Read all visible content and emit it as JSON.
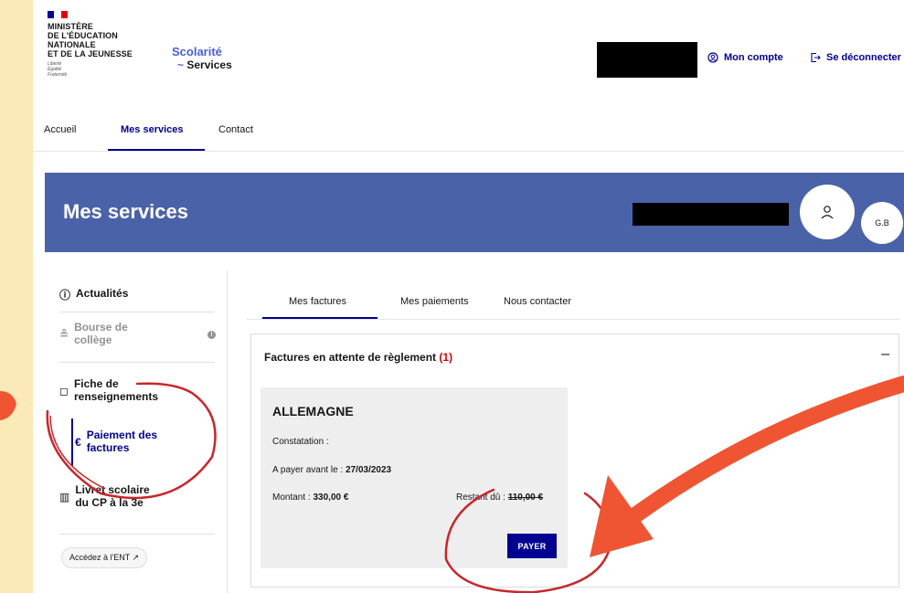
{
  "header": {
    "ministry_lines": [
      "MINISTÈRE",
      "DE L'ÉDUCATION",
      "NATIONALE",
      "ET DE LA JEUNESSE"
    ],
    "motto": [
      "Liberté",
      "Égalité",
      "Fraternité"
    ],
    "brand_top": "Scolarité",
    "brand_bottom": "Services",
    "account_label": "Mon compte",
    "logout_label": "Se déconnecter"
  },
  "nav": {
    "items": [
      "Accueil",
      "Mes services",
      "Contact"
    ],
    "active_index": 1
  },
  "banner": {
    "title": "Mes services",
    "initials": "G.B"
  },
  "sidebar": {
    "items": [
      {
        "label": "Actualités",
        "icon": "info-icon"
      },
      {
        "label_lines": [
          "Bourse de",
          "collège"
        ],
        "icon": "coins-icon"
      },
      {
        "label_lines": [
          "Fiche de",
          "renseignements"
        ],
        "icon": "form-icon"
      },
      {
        "label_lines": [
          "Paiement des",
          "factures"
        ],
        "icon": "euro-icon"
      },
      {
        "label_lines": [
          "Livret scolaire",
          "du CP à la 3e"
        ],
        "icon": "book-icon"
      }
    ],
    "ent_label": "Accédez à l'ENT"
  },
  "tabs": {
    "items": [
      "Mes factures",
      "Mes paiements",
      "Nous contacter"
    ],
    "active_index": 0
  },
  "accordion": {
    "title": "Factures en attente de règlement",
    "count": "(1)",
    "toggle": "–"
  },
  "invoice": {
    "title": "ALLEMAGNE",
    "constatation_label": "Constatation :",
    "due_label": "A payer avant le :",
    "due_date": "27/03/2023",
    "amount_label": "Montant :",
    "amount": "330,00 €",
    "remaining_label": "Restant dû :",
    "remaining": "110,00 €",
    "pay_label": "PAYER"
  },
  "colors": {
    "background": "#fbe9b7",
    "primary": "#000091",
    "banner": "#4a62a8",
    "annotation": "#c8262b",
    "arrow": "#ef5533"
  }
}
